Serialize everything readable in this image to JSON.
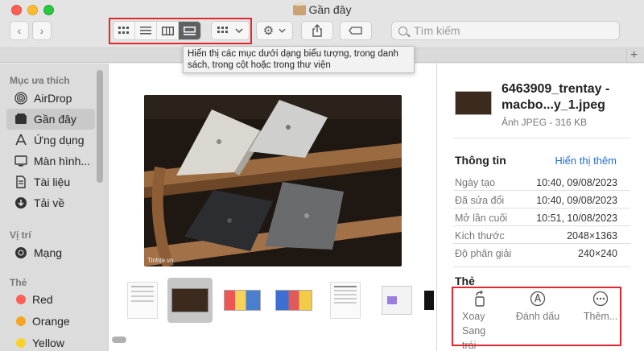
{
  "window": {
    "title": "Gần đây"
  },
  "toolbar": {
    "search_placeholder": "Tìm kiếm",
    "view_modes": [
      "icon-view",
      "list-view",
      "column-view",
      "gallery-view"
    ],
    "active_view": "gallery-view"
  },
  "tooltip": {
    "text": "Hiển thị các mục dưới dạng biểu tượng, trong danh sách, trong cột hoặc trong thư viện"
  },
  "sidebar": {
    "favorites_header": "Mục ưa thích",
    "favorites": [
      {
        "label": "AirDrop",
        "icon": "airdrop-icon"
      },
      {
        "label": "Gần đây",
        "icon": "clock-icon",
        "selected": true
      },
      {
        "label": "Ứng dụng",
        "icon": "applications-icon"
      },
      {
        "label": "Màn hình...",
        "icon": "desktop-icon"
      },
      {
        "label": "Tài liệu",
        "icon": "document-icon"
      },
      {
        "label": "Tải về",
        "icon": "download-icon"
      }
    ],
    "locations_header": "Vị trí",
    "locations": [
      {
        "label": "Mạng",
        "icon": "network-icon"
      }
    ],
    "tags_header": "Thẻ",
    "tags": [
      {
        "label": "Red",
        "color": "#fe5f57"
      },
      {
        "label": "Orange",
        "color": "#f5a623"
      },
      {
        "label": "Yellow",
        "color": "#f8d32b"
      }
    ]
  },
  "main": {
    "photo_watermark": "Tinhte.vn"
  },
  "panel": {
    "file_name": "6463909_trentay -macbo...y_1.jpeg",
    "file_kind": "Ảnh JPEG - 316 KB",
    "info_header": "Thông tin",
    "show_more": "Hiển thị thêm",
    "rows": [
      {
        "key": "Ngày tạo",
        "value": "10:40, 09/08/2023"
      },
      {
        "key": "Đã sửa đổi",
        "value": "10:40, 09/08/2023"
      },
      {
        "key": "Mở lần cuối",
        "value": "10:51, 10/08/2023"
      },
      {
        "key": "Kích thước",
        "value": "2048×1363"
      },
      {
        "key": "Độ phân giải",
        "value": "240×240"
      }
    ],
    "tags_header": "Thẻ",
    "actions": [
      {
        "label": "Xoay Sang trái",
        "icon": "rotate-left-icon"
      },
      {
        "label": "Đánh dấu",
        "icon": "markup-icon"
      },
      {
        "label": "Thêm...",
        "icon": "more-icon"
      }
    ]
  }
}
